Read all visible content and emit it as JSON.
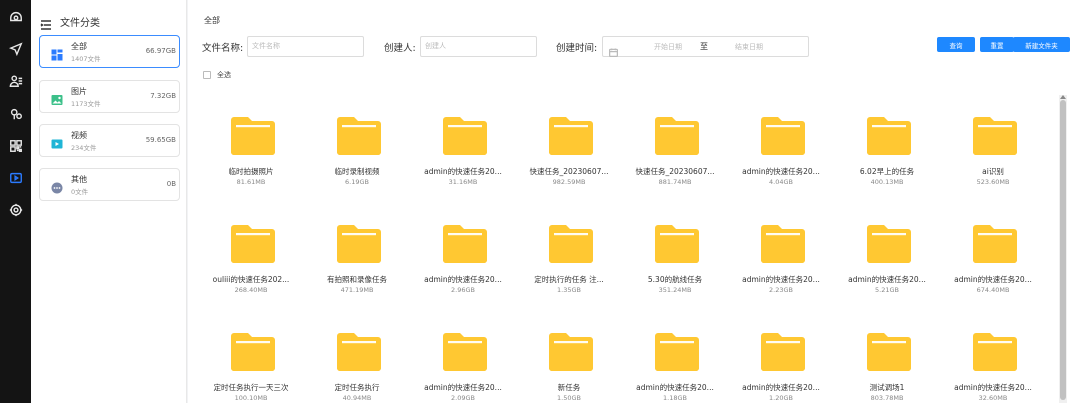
{
  "rail": {
    "icons": [
      "camera-icon",
      "send-icon",
      "user-card-icon",
      "location-icon",
      "qr-code-icon",
      "video-folder-icon",
      "gear-icon"
    ]
  },
  "sidebar": {
    "title": "文件分类",
    "items": [
      {
        "name": "全部",
        "count": "1407文件",
        "size": "66.97GB",
        "icon": "grid-icon",
        "active": true,
        "color": "#2b7bff"
      },
      {
        "name": "图片",
        "count": "1173文件",
        "size": "7.32GB",
        "icon": "image-icon",
        "active": false,
        "color": "#3cc08a"
      },
      {
        "name": "视频",
        "count": "234文件",
        "size": "59.65GB",
        "icon": "video-icon",
        "active": false,
        "color": "#1fb5d6"
      },
      {
        "name": "其他",
        "count": "0文件",
        "size": "0B",
        "icon": "more-icon",
        "active": false,
        "color": "#7a86a6"
      }
    ]
  },
  "main": {
    "breadcrumb": "全部",
    "filters": {
      "file_name_label": "文件名称:",
      "file_name_placeholder": "文件名称",
      "creator_label": "创建人:",
      "creator_placeholder": "创建人",
      "time_label": "创建时间:",
      "start_placeholder": "开始日期",
      "separator": "至",
      "end_placeholder": "结束日期"
    },
    "buttons": {
      "query": "查询",
      "reset": "重置",
      "new_folder": "新建文件夹"
    },
    "select_all": "全选",
    "folder_color": "#ffc832",
    "files": [
      {
        "name": "临时拍摄照片",
        "size": "81.61MB"
      },
      {
        "name": "临时录制视频",
        "size": "6.19GB"
      },
      {
        "name": "admin的快速任务20...",
        "size": "31.16MB"
      },
      {
        "name": "快速任务_20230607...",
        "size": "982.59MB"
      },
      {
        "name": "快速任务_20230607...",
        "size": "881.74MB"
      },
      {
        "name": "admin的快速任务20...",
        "size": "4.04GB"
      },
      {
        "name": "6.02早上的任务",
        "size": "400.13MB"
      },
      {
        "name": "ai识别",
        "size": "523.60MB"
      },
      {
        "name": "ouliii的快速任务202...",
        "size": "268.40MB"
      },
      {
        "name": "有拍照和录像任务",
        "size": "471.19MB"
      },
      {
        "name": "admin的快速任务20...",
        "size": "2.96GB"
      },
      {
        "name": "定时执行的任务 注...",
        "size": "1.35GB"
      },
      {
        "name": "5.30的航线任务",
        "size": "351.24MB"
      },
      {
        "name": "admin的快速任务20...",
        "size": "2.23GB"
      },
      {
        "name": "admin的快速任务20...",
        "size": "5.21GB"
      },
      {
        "name": "admin的快速任务20...",
        "size": "674.40MB"
      },
      {
        "name": "定时任务执行一天三次",
        "size": "100.10MB"
      },
      {
        "name": "定时任务执行",
        "size": "40.94MB"
      },
      {
        "name": "admin的快速任务20...",
        "size": "2.09GB"
      },
      {
        "name": "新任务",
        "size": "1.50GB"
      },
      {
        "name": "admin的快速任务20...",
        "size": "1.18GB"
      },
      {
        "name": "admin的快速任务20...",
        "size": "1.20GB"
      },
      {
        "name": "测试调场1",
        "size": "803.78MB"
      },
      {
        "name": "admin的快速任务20...",
        "size": "32.60MB"
      }
    ]
  }
}
